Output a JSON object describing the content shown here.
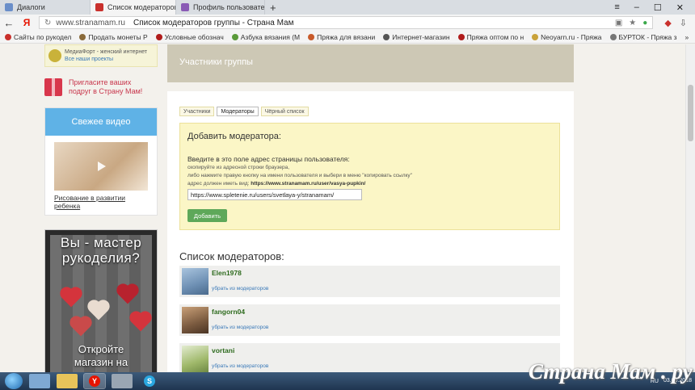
{
  "tabs": [
    {
      "title": "Диалоги",
      "favicon_color": "#6a8ec9"
    },
    {
      "title": "Список модераторов гр",
      "favicon_color": "#c9302c",
      "active": true
    },
    {
      "title": "Профиль пользователя Sve",
      "favicon_color": "#8a5bb5"
    }
  ],
  "address": {
    "host": "www.stranamam.ru",
    "title": "Список модераторов группы - Страна Мам"
  },
  "bookmarks": [
    {
      "label": "Сайты по рукодел",
      "color": "#c9302c"
    },
    {
      "label": "Продать монеты Р",
      "color": "#8a6a3a"
    },
    {
      "label": "Условные обознач",
      "color": "#b01c1c"
    },
    {
      "label": "Азбука вязания (М",
      "color": "#5a9a3a"
    },
    {
      "label": "Пряжа для вязани",
      "color": "#c85a2a"
    },
    {
      "label": "Интернет-магазин",
      "color": "#555"
    },
    {
      "label": "Пряжа оптом по н",
      "color": "#b01c1c"
    },
    {
      "label": "Neoyarn.ru - Пряжа",
      "color": "#c9a23a"
    },
    {
      "label": "БУРТОК - Пряжа з",
      "color": "#777"
    }
  ],
  "sidebar": {
    "mediafort_line1": "МедиаФорт - женский интернет",
    "mediafort_line2": "Все наши проекты",
    "invite_line1": "Пригласите ваших",
    "invite_line2": "подруг в Страну Мам!",
    "video_title": "Свежее видео",
    "video_link": "Рисование в развитии ребенка",
    "banner_line1": "Вы - мастер",
    "banner_line2": "рукоделия?",
    "banner_line3": "Откройте",
    "banner_line4": "магазин на"
  },
  "main": {
    "header_title": "Участники группы",
    "subtabs": [
      "Участники",
      "Модераторы",
      "Чёрный список"
    ],
    "add_title": "Добавить модератора:",
    "add_instruction": "Введите в это поле адрес страницы пользователя:",
    "add_hint1": "скопируйте из адресной строки браузера,",
    "add_hint2": "либо нажмите правую кнопку на имени пользователя и выбери в меню \"копировать ссылку\"",
    "add_hint3_prefix": "адрес должен иметь вид:",
    "add_hint3_example": "https://www.stranamam.ru/user/vasya-pupkin/",
    "add_input_value": "https://www.spletenie.ru/users/svetlaya-y/stranamam/",
    "add_button": "Добавить",
    "list_title": "Список модераторов:",
    "remove_label": "убрать из модераторов",
    "moderators": [
      {
        "name": "Elen1978",
        "avatar_color": "#6d8fb3"
      },
      {
        "name": "fangorn04",
        "avatar_color": "#7a5a3f"
      },
      {
        "name": "vortani",
        "avatar_color": "#9fb86a"
      }
    ]
  },
  "taskbar": {
    "lang": "RU",
    "date": "03.06.2018"
  },
  "watermark": "Страна Мам . ру"
}
